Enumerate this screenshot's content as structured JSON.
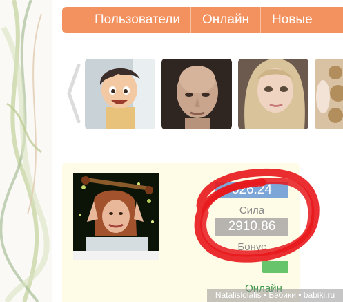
{
  "nav": {
    "items": [
      {
        "label": "Пользователи"
      },
      {
        "label": "Онлайн"
      },
      {
        "label": "Новые"
      }
    ]
  },
  "carousel": {
    "thumbnails": [
      {
        "icon": "cartoon-boy-doll-photo"
      },
      {
        "icon": "bald-doll-head-photo"
      },
      {
        "icon": "blonde-doll-photo"
      },
      {
        "icon": "curly-hair-doll-photo"
      }
    ]
  },
  "profile": {
    "avatar_icon": "user-photo",
    "stat_top_value": "526.24",
    "strength_label": "Сила",
    "strength_value": "2910.86",
    "bonus_label": "Бонус",
    "status": "Онлайн"
  },
  "watermark": "Natalislolalis • Бэбики • babiki.ru",
  "colors": {
    "nav": "#f3915f",
    "card": "#fefbe6",
    "stat_top": "#7da6d8",
    "stat_value": "#b7b4b0",
    "online": "#3e9a4d",
    "scribble": "#e8171c"
  }
}
